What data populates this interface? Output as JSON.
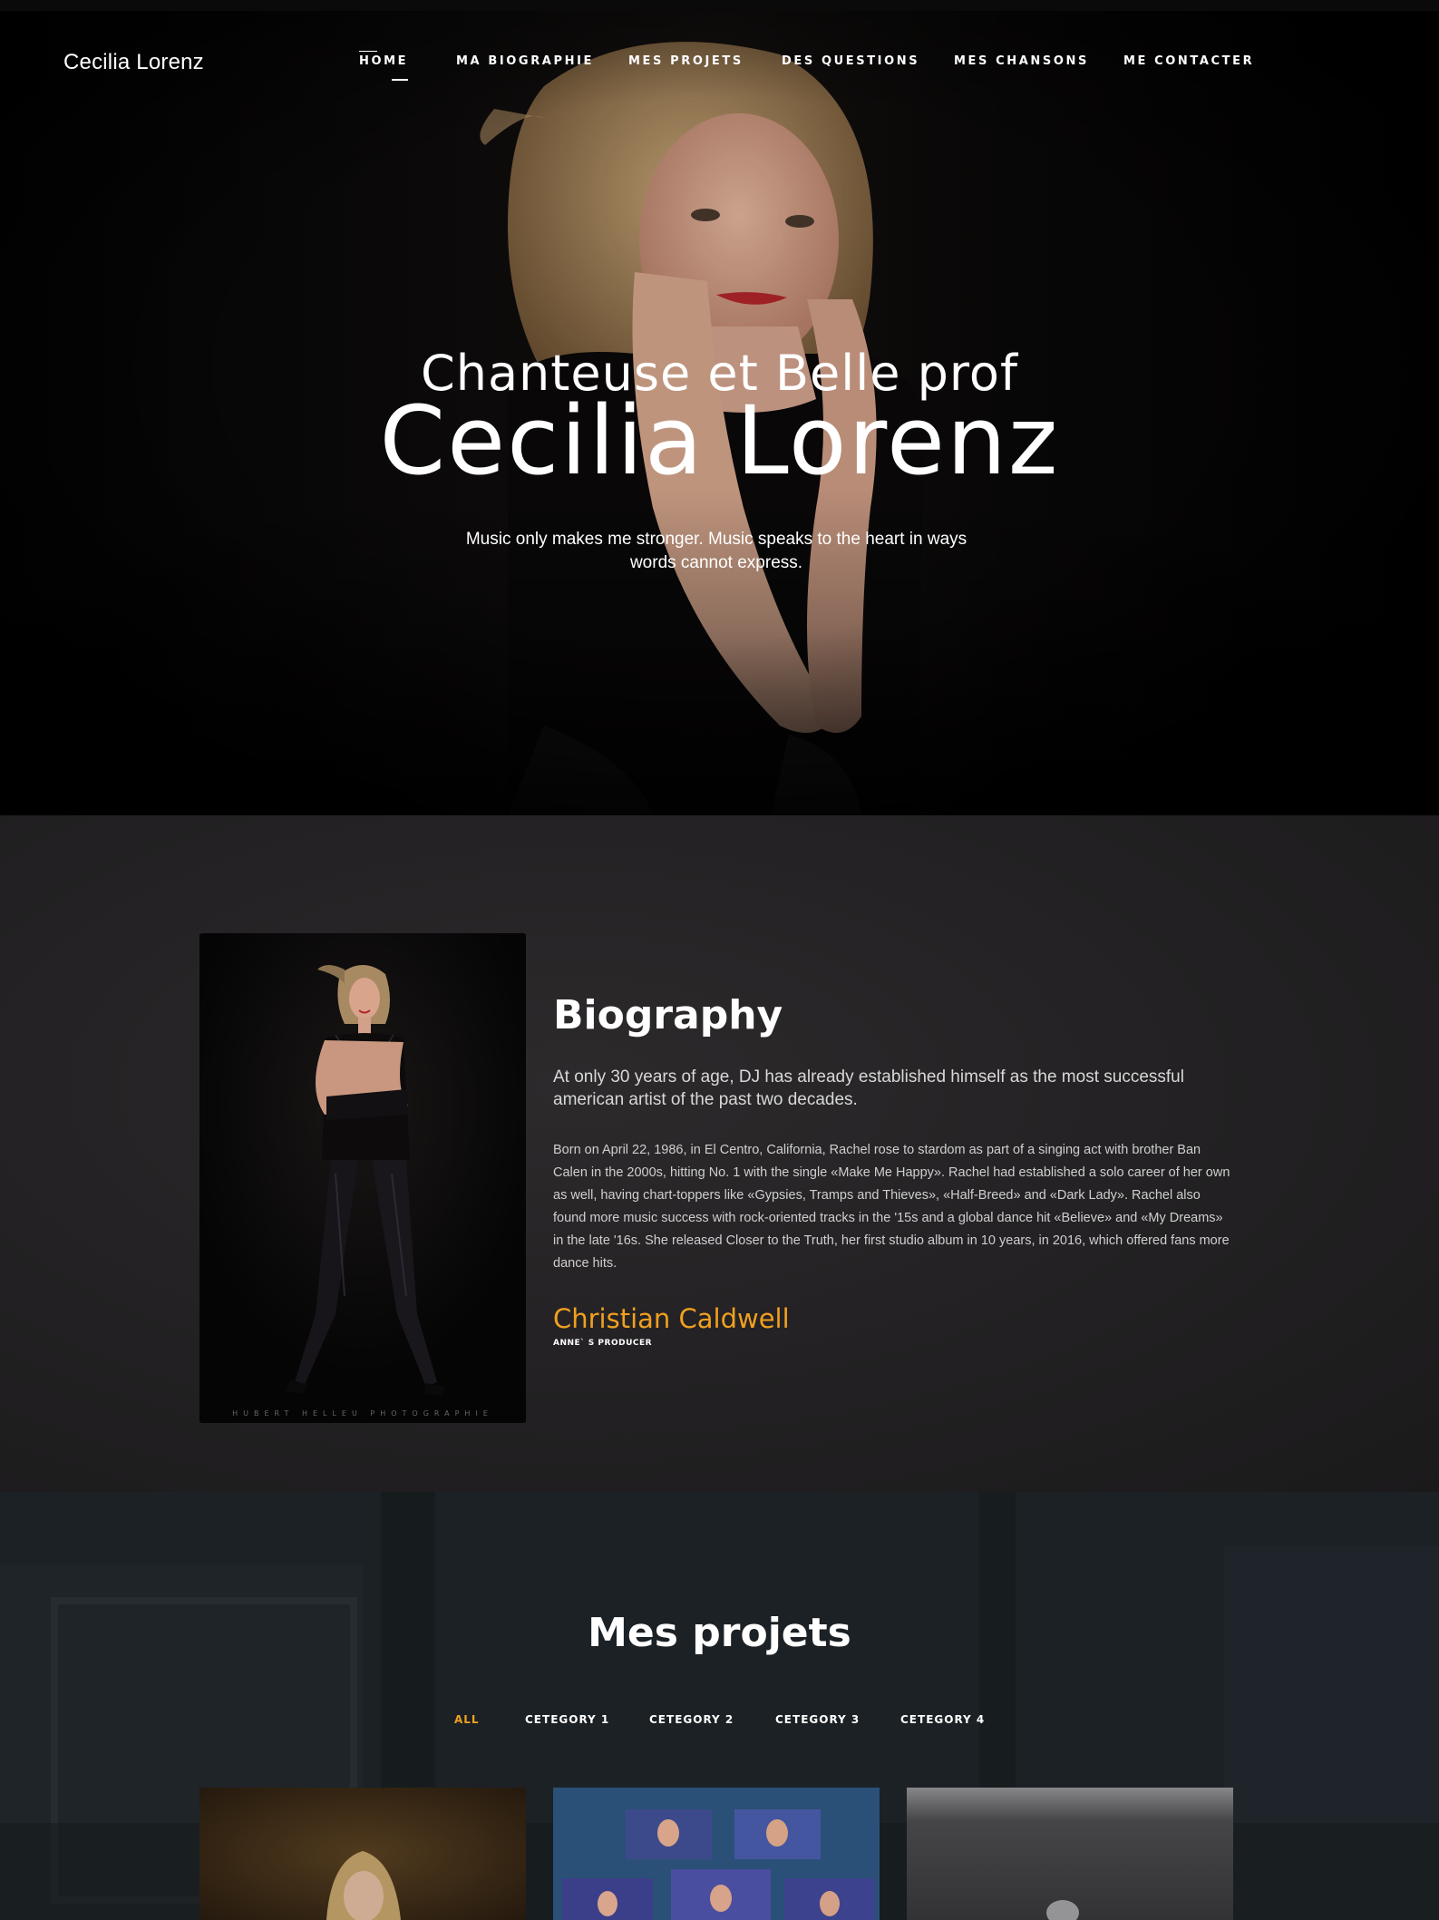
{
  "brand": "Cecilia Lorenz",
  "nav": {
    "items": [
      {
        "label": "HOME",
        "active": true
      },
      {
        "label": "MA BIOGRAPHIE",
        "active": false
      },
      {
        "label": "MES PROJETS",
        "active": false
      },
      {
        "label": "DES QUESTIONS",
        "active": false
      },
      {
        "label": "MES CHANSONS",
        "active": false
      },
      {
        "label": "ME CONTACTER",
        "active": false
      }
    ]
  },
  "hero": {
    "subtitle": "Chanteuse et Belle prof",
    "title": "Cecilia Lorenz",
    "quote": "Music only makes me stronger. Music speaks to the heart in ways words cannot express."
  },
  "bio": {
    "heading": "Biography",
    "lead": "At only 30 years of age, DJ has already established himself as the most successful american artist of the past two decades.",
    "text": "Born on April 22, 1986, in El Centro, California, Rachel rose to stardom as part of a singing act with brother Ban Calen in the 2000s, hitting No. 1 with the single «Make Me Happy». Rachel had established a solo career of her own as well, having chart-toppers like «Gypsies, Tramps and Thieves», «Half-Breed» and «Dark Lady». Rachel also found more music success with rock-oriented tracks in the '15s and a global dance hit «Believe» and «My Dreams» in the late '16s. She released Closer to the Truth, her first studio album in 10 years, in 2016, which offered fans more dance hits.",
    "signature": "Christian Caldwell",
    "role": "ANNE` S PRODUCER",
    "photo_caption": "HUBERT HELLEU PHOTOGRAPHIE"
  },
  "projects": {
    "heading": "Mes projets",
    "filters": [
      {
        "label": "ALL",
        "active": true
      },
      {
        "label": "CETEGORY 1",
        "active": false
      },
      {
        "label": "CETEGORY 2",
        "active": false
      },
      {
        "label": "CETEGORY 3",
        "active": false
      },
      {
        "label": "CETEGORY 4",
        "active": false
      }
    ]
  },
  "colors": {
    "accent": "#f0a01f",
    "hero_bg": "#0a0808",
    "bio_bg": "#242224",
    "projects_bg": "#1c2226"
  }
}
